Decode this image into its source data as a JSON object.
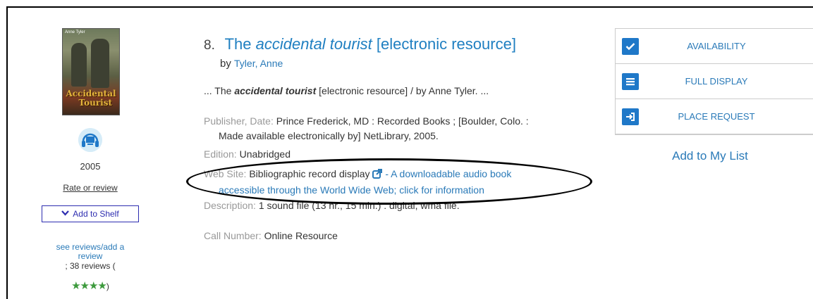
{
  "record": {
    "number": "8.",
    "title_italic": "The accidental tourist",
    "title_prefix": "The",
    "title_em": "accidental tourist",
    "title_suffix": "[electronic resource]",
    "by": "by",
    "author": "Tyler, Anne",
    "snippet_start": "... The",
    "snippet_em": "accidental tourist",
    "snippet_end": "[electronic resource] / by Anne Tyler. ...",
    "publisher_label": "Publisher, Date:",
    "publisher_value_line1": "Prince Frederick, MD : Recorded Books ; [Boulder, Colo. :",
    "publisher_value_line2": "Made available electronically by] NetLibrary, 2005.",
    "edition_label": "Edition:",
    "edition_value": "Unabridged",
    "website_label": "Web Site:",
    "website_value": "Bibliographic record display",
    "website_link_line1": "- A downloadable audio book",
    "website_link_line2": "accessible through the World Wide Web; click for information",
    "description_label": "Description:",
    "description_value": "1 sound file (13 hr., 15 min.) : digital, wma file.",
    "callnumber_label": "Call Number:",
    "callnumber_value": "Online Resource"
  },
  "cover": {
    "top_text": "Anne Tyler",
    "title_line1": "Accidental",
    "title_line2": "Tourist"
  },
  "left": {
    "year": "2005",
    "rate_link": "Rate or review",
    "shelf_button": "Add to Shelf",
    "see_reviews_line1": "see reviews/add a",
    "see_reviews_line2": "review",
    "review_count": "; 38 reviews (",
    "stars": "★★★★",
    "rating": 4,
    "stars_close": ")"
  },
  "actions": [
    {
      "label": "AVAILABILITY",
      "icon": "checkmark-icon"
    },
    {
      "label": "FULL DISPLAY",
      "icon": "details-list-icon"
    },
    {
      "label": "PLACE REQUEST",
      "icon": "sign-in-arrow-icon"
    }
  ],
  "add_to_list": "Add to My List",
  "colors": {
    "link": "#2a7ab8",
    "title": "#1f7fc1",
    "action_icon_bg": "#1f78c8",
    "stars": "#3c9a3c",
    "shelf_border": "#2d2db0"
  }
}
